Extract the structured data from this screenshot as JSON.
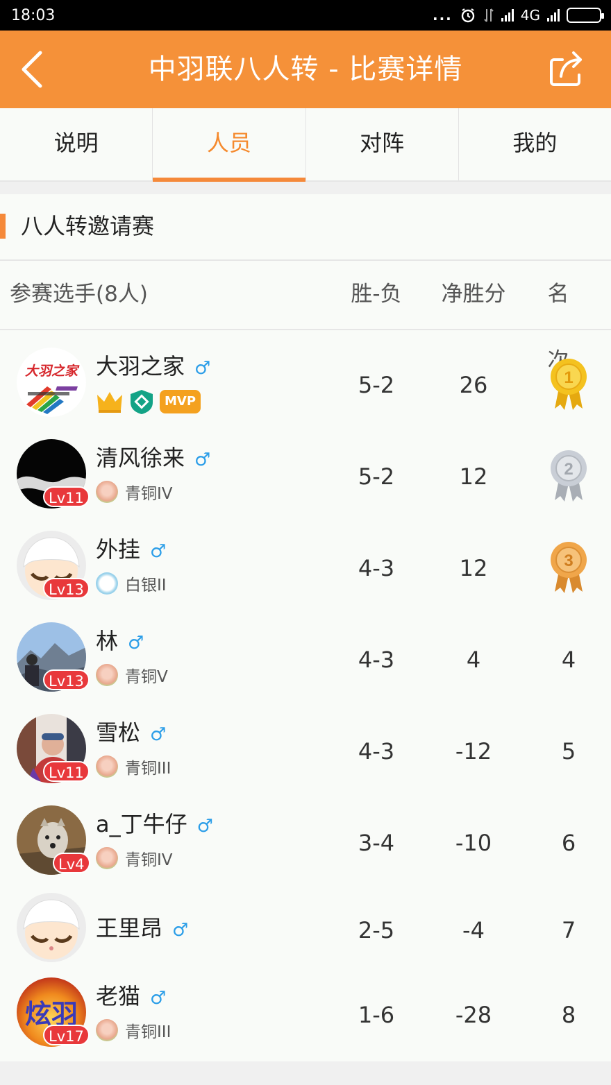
{
  "status_bar": {
    "time": "18:03",
    "dots": "...",
    "network": "4G"
  },
  "app_bar": {
    "title": "中羽联八人转 - 比赛详情"
  },
  "tabs": [
    {
      "label": "说明",
      "active": false
    },
    {
      "label": "人员",
      "active": true
    },
    {
      "label": "对阵",
      "active": false
    },
    {
      "label": "我的",
      "active": false
    }
  ],
  "section": {
    "title": "八人转邀请赛"
  },
  "table_header": {
    "players": "参赛选手(8人)",
    "win_loss": "胜-负",
    "net_points": "净胜分",
    "rank": "名次"
  },
  "players": [
    {
      "name": "大羽之家",
      "gender_symbol": "♂",
      "win_loss": "5-2",
      "net_points": "26",
      "rank": "1",
      "badges": [
        "crown-icon",
        "shield-icon",
        "MVP"
      ]
    },
    {
      "name": "清风徐来",
      "gender_symbol": "♂",
      "level": "Lv11",
      "tier": "青铜IV",
      "win_loss": "5-2",
      "net_points": "12",
      "rank": "2"
    },
    {
      "name": "外挂",
      "gender_symbol": "♂",
      "level": "Lv13",
      "tier": "白银II",
      "win_loss": "4-3",
      "net_points": "12",
      "rank": "3"
    },
    {
      "name": "林",
      "gender_symbol": "♂",
      "level": "Lv13",
      "tier": "青铜V",
      "win_loss": "4-3",
      "net_points": "4",
      "rank": "4"
    },
    {
      "name": "雪松",
      "gender_symbol": "♂",
      "level": "Lv11",
      "tier": "青铜III",
      "win_loss": "4-3",
      "net_points": "-12",
      "rank": "5"
    },
    {
      "name": "a_丁牛仔",
      "gender_symbol": "♂",
      "level": "Lv4",
      "tier": "青铜IV",
      "win_loss": "3-4",
      "net_points": "-10",
      "rank": "6"
    },
    {
      "name": "王里昂",
      "gender_symbol": "♂",
      "win_loss": "2-5",
      "net_points": "-4",
      "rank": "7"
    },
    {
      "name": "老猫",
      "gender_symbol": "♂",
      "level": "Lv17",
      "tier": "青铜III",
      "win_loss": "1-6",
      "net_points": "-28",
      "rank": "8"
    }
  ],
  "logo_text": {
    "club": "大羽之家",
    "xuanyu": "炫羽"
  },
  "colors": {
    "accent": "#f59139",
    "gold": "#f4c21f",
    "silver": "#c9ced6",
    "bronze": "#f0a64a",
    "level_badge": "#e8383b",
    "male": "#2c9ee8"
  }
}
